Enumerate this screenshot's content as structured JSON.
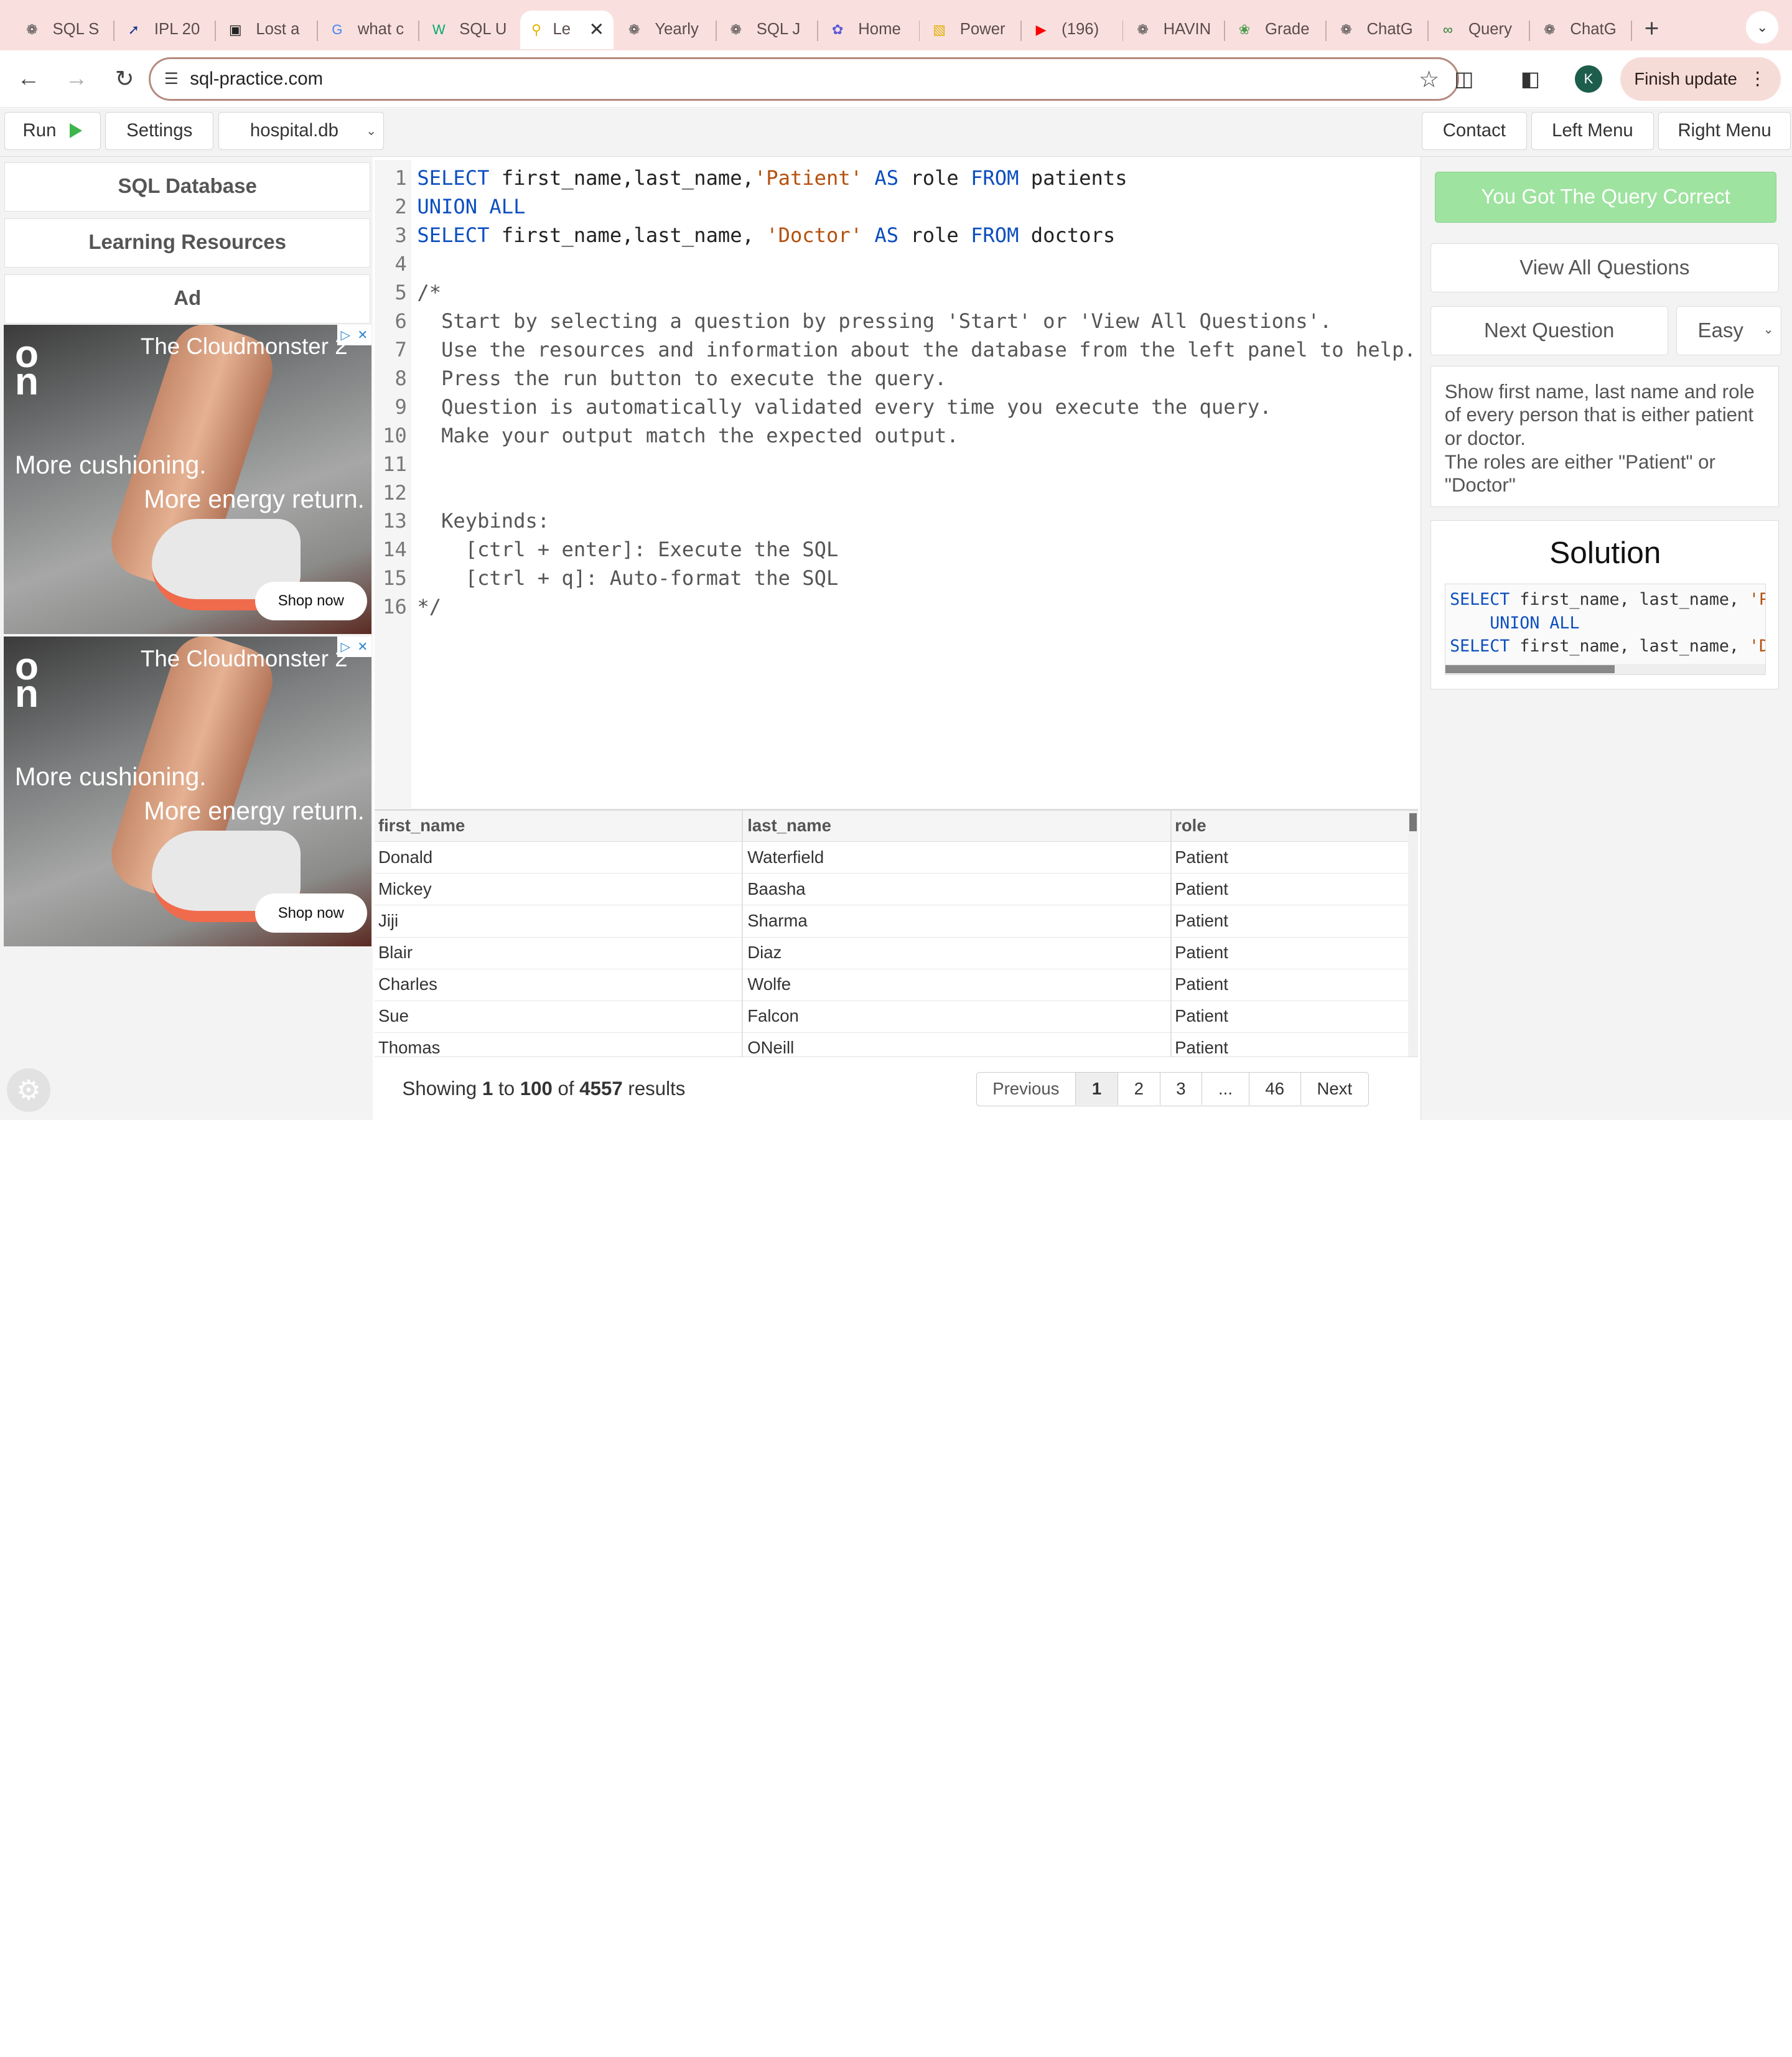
{
  "browser": {
    "tabs": [
      {
        "title": "SQL S",
        "icon": "chatgpt-icon",
        "color": "#444"
      },
      {
        "title": "IPL 20",
        "icon": "ipl-icon",
        "color": "#1a3a8a"
      },
      {
        "title": "Lost a",
        "icon": "image-icon",
        "color": "#222"
      },
      {
        "title": "what c",
        "icon": "google-icon",
        "color": "#4285f4"
      },
      {
        "title": "SQL U",
        "icon": "w3schools-icon",
        "color": "#04aa6d"
      },
      {
        "title": "Le",
        "icon": "key-icon",
        "color": "#e5b400",
        "active": true
      },
      {
        "title": "Yearly",
        "icon": "chatgpt-icon",
        "color": "#444"
      },
      {
        "title": "SQL J",
        "icon": "chatgpt-icon",
        "color": "#444"
      },
      {
        "title": "Home",
        "icon": "copilot-icon",
        "color": "#5b5bd6"
      },
      {
        "title": "Power",
        "icon": "powerbi-icon",
        "color": "#e2b100"
      },
      {
        "title": "(196)",
        "icon": "youtube-icon",
        "color": "#ff0000"
      },
      {
        "title": "HAVIN",
        "icon": "chatgpt-icon",
        "color": "#444"
      },
      {
        "title": "Grade",
        "icon": "plant-icon",
        "color": "#4a9a4a"
      },
      {
        "title": "ChatG",
        "icon": "chatgpt-icon",
        "color": "#444"
      },
      {
        "title": "Query",
        "icon": "infinity-icon",
        "color": "#2e7d32"
      },
      {
        "title": "ChatG",
        "icon": "chatgpt-icon",
        "color": "#444"
      }
    ],
    "url": "sql-practice.com",
    "profile_initial": "K",
    "finish_update": "Finish update"
  },
  "appbar": {
    "run": "Run",
    "settings": "Settings",
    "database": "hospital.db",
    "contact": "Contact",
    "left_menu": "Left Menu",
    "right_menu": "Right Menu"
  },
  "left_panel": {
    "sql_database": "SQL Database",
    "learning_resources": "Learning Resources",
    "ad_label": "Ad",
    "ads": [
      {
        "headline": "The Cloudmonster 2",
        "line1": "More cushioning.",
        "line2": "More energy return.",
        "cta": "Shop now"
      },
      {
        "headline": "The Cloudmonster 2",
        "line1": "More cushioning.",
        "line2": "More energy return.",
        "cta": "Shop now"
      }
    ]
  },
  "editor": {
    "lines": [
      {
        "n": "1",
        "parts": [
          [
            "kw",
            "SELECT"
          ],
          [
            "",
            ""
          ],
          [
            "",
            " first_name,last_name,"
          ],
          [
            "str",
            "'Patient'"
          ],
          [
            "",
            " "
          ],
          [
            "kw",
            "AS"
          ],
          [
            "",
            " role "
          ],
          [
            "kw",
            "FROM"
          ],
          [
            "",
            " patients"
          ]
        ]
      },
      {
        "n": "2",
        "parts": [
          [
            "kw",
            "UNION ALL"
          ]
        ]
      },
      {
        "n": "3",
        "parts": [
          [
            "kw",
            "SELECT"
          ],
          [
            "",
            " first_name,last_name, "
          ],
          [
            "str",
            "'Doctor'"
          ],
          [
            "",
            " "
          ],
          [
            "kw",
            "AS"
          ],
          [
            "",
            " role "
          ],
          [
            "kw",
            "FROM"
          ],
          [
            "",
            " doctors"
          ]
        ]
      },
      {
        "n": "4",
        "parts": []
      },
      {
        "n": "5",
        "parts": [
          [
            "cm",
            "/*"
          ]
        ]
      },
      {
        "n": "6",
        "parts": [
          [
            "cm",
            "  Start by selecting a question by pressing 'Start' or 'View All Questions'."
          ]
        ]
      },
      {
        "n": "7",
        "parts": [
          [
            "cm",
            "  Use the resources and information about the database from the left panel to help."
          ]
        ]
      },
      {
        "n": "8",
        "parts": [
          [
            "cm",
            "  Press the run button to execute the query."
          ]
        ]
      },
      {
        "n": "9",
        "parts": [
          [
            "cm",
            "  Question is automatically validated every time you execute the query."
          ]
        ]
      },
      {
        "n": "10",
        "parts": [
          [
            "cm",
            "  Make your output match the expected output."
          ]
        ]
      },
      {
        "n": "11",
        "parts": []
      },
      {
        "n": "12",
        "parts": []
      },
      {
        "n": "13",
        "parts": [
          [
            "cm",
            "  Keybinds:"
          ]
        ]
      },
      {
        "n": "14",
        "parts": [
          [
            "cm",
            "    [ctrl + enter]: Execute the SQL"
          ]
        ]
      },
      {
        "n": "15",
        "parts": [
          [
            "cm",
            "    [ctrl + q]: Auto-format the SQL"
          ]
        ]
      },
      {
        "n": "16",
        "parts": [
          [
            "cm",
            "*/"
          ]
        ]
      }
    ]
  },
  "results": {
    "columns": [
      "first_name",
      "last_name",
      "role"
    ],
    "rows": [
      [
        "Donald",
        "Waterfield",
        "Patient"
      ],
      [
        "Mickey",
        "Baasha",
        "Patient"
      ],
      [
        "Jiji",
        "Sharma",
        "Patient"
      ],
      [
        "Blair",
        "Diaz",
        "Patient"
      ],
      [
        "Charles",
        "Wolfe",
        "Patient"
      ],
      [
        "Sue",
        "Falcon",
        "Patient"
      ],
      [
        "Thomas",
        "ONeill",
        "Patient"
      ]
    ],
    "showing_prefix": "Showing",
    "from": "1",
    "to_word": "to",
    "to": "100",
    "of_word": "of",
    "total": "4557",
    "results_word": "results",
    "pager": {
      "previous": "Previous",
      "pages": [
        "1",
        "2",
        "3",
        "...",
        "46"
      ],
      "next": "Next"
    }
  },
  "right_panel": {
    "correct": "You Got The Query Correct",
    "view_all": "View All Questions",
    "next_question": "Next Question",
    "difficulty": "Easy",
    "question": "Show first name, last name and role of every person that is either patient or doctor.\nThe roles are either \"Patient\" or \"Doctor\"",
    "solution_title": "Solution",
    "solution_lines": [
      [
        [
          "kw",
          "SELECT"
        ],
        [
          "",
          " first_name, last_name, "
        ],
        [
          "str",
          "'Pa"
        ]
      ],
      [
        [
          "",
          "    "
        ],
        [
          "kw",
          "UNION ALL"
        ]
      ],
      [
        [
          "kw",
          "SELECT"
        ],
        [
          "",
          " first_name, last_name, "
        ],
        [
          "str",
          "'Do"
        ]
      ]
    ]
  }
}
